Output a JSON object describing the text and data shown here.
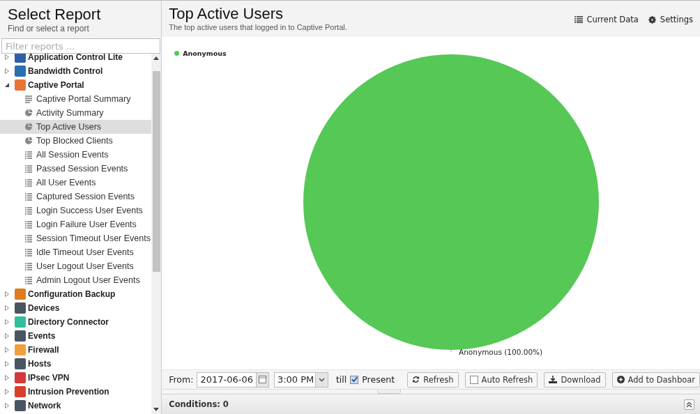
{
  "sidebar": {
    "title": "Select Report",
    "subtitle": "Find or select a report",
    "filter": {
      "placeholder": "Filter reports ..."
    },
    "groups": [
      {
        "label": "Application Control Lite",
        "color": "#2f5fa8",
        "expanded": false
      },
      {
        "label": "Bandwidth Control",
        "color": "#2a6fb0",
        "expanded": false
      },
      {
        "label": "Captive Portal",
        "color": "#e8743a",
        "expanded": true,
        "children": [
          {
            "label": "Captive Portal Summary",
            "kind": "summary",
            "selected": false
          },
          {
            "label": "Activity Summary",
            "kind": "pie",
            "selected": false
          },
          {
            "label": "Top Active Users",
            "kind": "pie",
            "selected": true
          },
          {
            "label": "Top Blocked Clients",
            "kind": "pie",
            "selected": false
          },
          {
            "label": "All Session Events",
            "kind": "list",
            "selected": false
          },
          {
            "label": "Passed Session Events",
            "kind": "list",
            "selected": false
          },
          {
            "label": "All User Events",
            "kind": "list",
            "selected": false
          },
          {
            "label": "Captured Session Events",
            "kind": "list",
            "selected": false
          },
          {
            "label": "Login Success User Events",
            "kind": "list",
            "selected": false
          },
          {
            "label": "Login Failure User Events",
            "kind": "list",
            "selected": false
          },
          {
            "label": "Session Timeout User Events",
            "kind": "list",
            "selected": false
          },
          {
            "label": "Idle Timeout User Events",
            "kind": "list",
            "selected": false
          },
          {
            "label": "User Logout User Events",
            "kind": "list",
            "selected": false
          },
          {
            "label": "Admin Logout User Events",
            "kind": "list",
            "selected": false
          }
        ]
      },
      {
        "label": "Configuration Backup",
        "color": "#e07b1e",
        "expanded": false
      },
      {
        "label": "Devices",
        "color": "#4a5563",
        "expanded": false
      },
      {
        "label": "Directory Connector",
        "color": "#2fbfa0",
        "expanded": false
      },
      {
        "label": "Events",
        "color": "#4a5563",
        "expanded": false
      },
      {
        "label": "Firewall",
        "color": "#f0a03a",
        "expanded": false
      },
      {
        "label": "Hosts",
        "color": "#4a5563",
        "expanded": false
      },
      {
        "label": "IPsec VPN",
        "color": "#d23a3a",
        "expanded": false
      },
      {
        "label": "Intrusion Prevention",
        "color": "#d8402a",
        "expanded": false
      },
      {
        "label": "Network",
        "color": "#4a5563",
        "expanded": false
      }
    ]
  },
  "report": {
    "title": "Top Active Users",
    "description": "The top active users that logged in to Captive Portal.",
    "actions": [
      {
        "label": "Current Data",
        "kind": "data"
      },
      {
        "label": "Settings",
        "kind": "settings"
      }
    ],
    "chart_data": {
      "type": "pie",
      "series": [
        {
          "name": "Anonymous",
          "color": "#55c855",
          "values": [
            100
          ]
        }
      ],
      "value_labels": [
        "Anonymous (100.00%)"
      ]
    }
  },
  "toolbar": {
    "from_label": "From:",
    "date": "2017-06-06",
    "time": "3:00 PM",
    "till_label": "till",
    "present": {
      "label": "Present",
      "checked": true
    },
    "buttons": [
      {
        "label": "Refresh",
        "kind": "refresh"
      },
      {
        "label": "Auto Refresh",
        "kind": "checkbox",
        "checked": false
      },
      {
        "label": "Download",
        "kind": "download"
      },
      {
        "label": "Add to Dashboar",
        "kind": "add"
      }
    ]
  },
  "conditions": {
    "label": "Conditions: 0"
  }
}
